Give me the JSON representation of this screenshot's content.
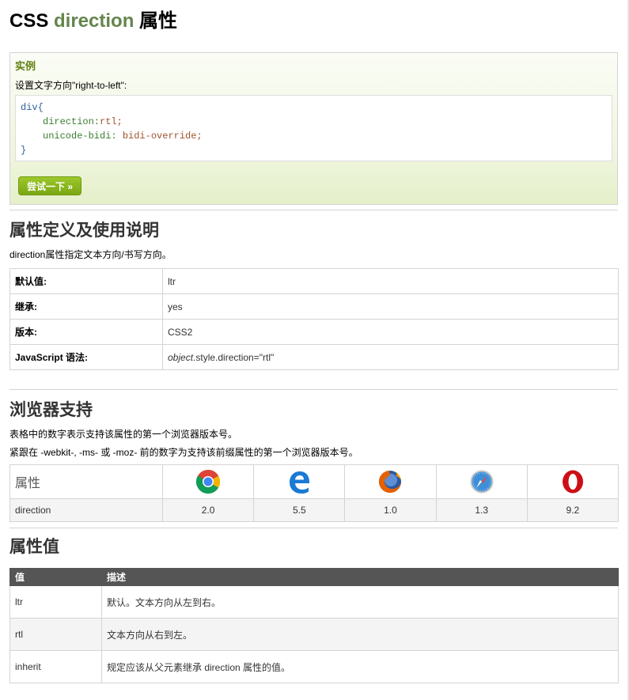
{
  "title": {
    "prefix": "CSS ",
    "highlight": "direction",
    "suffix": " 属性"
  },
  "example": {
    "heading": "实例",
    "intro": "设置文字方向\"right-to-left\":",
    "code": {
      "line1": "div{",
      "line2_prop": "direction:",
      "line2_val": "rtl;",
      "line3_prop": "unicode-bidi: ",
      "line3_val": "bidi-override;",
      "line4": "}"
    },
    "try_button": "尝试一下 »"
  },
  "definition": {
    "heading": "属性定义及使用说明",
    "description": "direction属性指定文本方向/书写方向。",
    "rows": [
      {
        "key": "默认值:",
        "value": "ltr"
      },
      {
        "key": "继承:",
        "value": "yes"
      },
      {
        "key": "版本:",
        "value": "CSS2"
      },
      {
        "key": "JavaScript 语法:",
        "value_italic": "object",
        "value_rest": ".style.direction=\"rtl\""
      }
    ]
  },
  "browser_support": {
    "heading": "浏览器支持",
    "note1": "表格中的数字表示支持该属性的第一个浏览器版本号。",
    "note2": "紧跟在 -webkit-, -ms- 或 -moz- 前的数字为支持该前缀属性的第一个浏览器版本号。",
    "header_label": "属性",
    "browsers": [
      "chrome-icon",
      "edge-icon",
      "firefox-icon",
      "safari-icon",
      "opera-icon"
    ],
    "row": {
      "property": "direction",
      "versions": [
        "2.0",
        "5.5",
        "1.0",
        "1.3",
        "9.2"
      ]
    }
  },
  "values": {
    "heading": "属性值",
    "columns": [
      "值",
      "描述"
    ],
    "rows": [
      {
        "value": "ltr",
        "desc": "默认。文本方向从左到右。"
      },
      {
        "value": "rtl",
        "desc": "文本方向从右到左。"
      },
      {
        "value": "inherit",
        "desc": "规定应该从父元素继承 direction 属性的值。"
      }
    ]
  }
}
